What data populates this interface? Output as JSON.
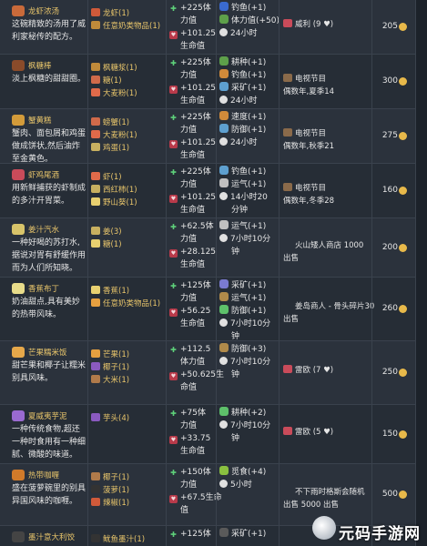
{
  "dishes": [
    {
      "name": "龙虾浓汤",
      "desc": "这碗精致的汤用了威\n利家秘传的配方。",
      "ingredients": [
        {
          "name": "龙虾(1)"
        },
        {
          "name": "任意奶类物品(1)"
        }
      ],
      "stats": [
        "+225体",
        "力值",
        "+101.25",
        "生命值"
      ],
      "buffs": [
        "钓鱼(+1)",
        "体力值(+50)",
        "24小时"
      ],
      "source": "威利 (9 ♥)",
      "price": "205"
    },
    {
      "name": "枫糖棒",
      "desc": "淡上枫糖的甜甜圈。",
      "ingredients": [
        {
          "name": "枫糖浆(1)"
        },
        {
          "name": "糖(1)"
        },
        {
          "name": "大麦粉(1)"
        }
      ],
      "stats": [
        "+225体",
        "力值",
        "+101.25",
        "生命值"
      ],
      "buffs": [
        "耕种(+1)",
        "钓鱼(+1)",
        "采矿(+1)",
        "24小时"
      ],
      "source": "电视节目\n偶数年,夏季14",
      "price": "300"
    },
    {
      "name": "蟹黄糕",
      "desc": "蟹肉、面包屑和鸡蛋\n做成饼状,然后油炸\n至金黄色。",
      "ingredients": [
        {
          "name": "螃蟹(1)"
        },
        {
          "name": "大麦粉(1)"
        },
        {
          "name": "鸡蛋(1)"
        }
      ],
      "stats": [
        "+225体",
        "力值",
        "+101.25",
        "生命值"
      ],
      "buffs": [
        "速度(+1)",
        "防御(+1)",
        "24小时"
      ],
      "source": "电视节目\n偶数年,秋季21",
      "price": "275"
    },
    {
      "name": "虾鸡尾酒",
      "desc": "用新鲜捕获的虾制成\n的多汁开胃菜。",
      "ingredients": [
        {
          "name": "虾(1)"
        },
        {
          "name": "西红柿(1)"
        },
        {
          "name": "野山葵(1)"
        }
      ],
      "stats": [
        "+225体",
        "力值",
        "+101.25",
        "生命值"
      ],
      "buffs": [
        "钓鱼(+1)",
        "运气(+1)",
        "14小时20",
        "分钟"
      ],
      "source": "电视节目\n偶数年,冬季28",
      "price": "160"
    },
    {
      "name": "姜汁汽水",
      "desc": "一种好喝的苏打水,\n据说对胃有舒缓作用\n而为人们所知晓。",
      "ingredients": [
        {
          "name": "姜(3)"
        },
        {
          "name": "糖(1)"
        }
      ],
      "stats": [
        "+62.5体",
        "力值",
        "+28.125",
        "生命值"
      ],
      "buffs": [
        "运气(+1)",
        "7小时10分",
        "钟"
      ],
      "source": "火山矮人商店  1000\n出售",
      "price": "200"
    },
    {
      "name": "香蕉布丁",
      "desc": "奶油甜点,具有美妙\n的热带风味。",
      "ingredients": [
        {
          "name": "香蕉(1)"
        },
        {
          "name": "任意奶类物品(1)"
        }
      ],
      "stats": [
        "+125体",
        "力值",
        "+56.25",
        "生命值"
      ],
      "buffs": [
        "采矿(+1)",
        "运气(+1)",
        "防御(+1)",
        "7小时10分",
        "钟"
      ],
      "source": "姜岛商人 - 骨头碎片30\n出售",
      "price": "260"
    },
    {
      "name": "芒果糯米饭",
      "desc": "甜芒果和椰子让糯米\n别具风味。",
      "ingredients": [
        {
          "name": "芒果(1)"
        },
        {
          "name": "椰子(1)"
        },
        {
          "name": "大米(1)"
        }
      ],
      "stats": [
        "+112.5",
        "体力值",
        "+50.625生",
        "命值"
      ],
      "buffs": [
        "防御(+3)",
        "7小时10分",
        "钟"
      ],
      "source": "雷欧 (7 ♥)",
      "price": "250"
    },
    {
      "name": "夏威夷芋泥",
      "desc": "一种传统食物,超还\n一种时食用有一种细\n腻、微酸的味道。",
      "ingredients": [
        {
          "name": "芋头(4)"
        }
      ],
      "stats": [
        "+75体",
        "力值",
        "+33.75",
        "生命值"
      ],
      "buffs": [
        "耕种(+2)",
        "7小时10分",
        "钟"
      ],
      "source": "雷欧 (5 ♥)",
      "price": "150"
    },
    {
      "name": "热带咖喱",
      "desc": "盛在菠萝碗里的别具\n异国风味的咖喱。",
      "ingredients": [
        {
          "name": "椰子(1)"
        },
        {
          "name": "菠萝(1)"
        },
        {
          "name": "辣椒(1)"
        }
      ],
      "stats": [
        "+150体",
        "力值",
        "+67.5生命",
        "值"
      ],
      "buffs": [
        "觅食(+4)",
        "5小时"
      ],
      "source": "不下雨时格斯会随机\n出售  5000 出售",
      "price": "500"
    },
    {
      "name": "墨汁意大利饺",
      "desc": "",
      "ingredients": [
        {
          "name": "鱿鱼墨汁(1)"
        }
      ],
      "stats": [
        "+125体"
      ],
      "buffs": [
        "采矿(+1)"
      ],
      "source": "",
      "price": ""
    }
  ],
  "colors": {
    "accent_gold": "#e8c56b",
    "plus_green": "#5ed17a",
    "heart_red": "#b83a4a",
    "coin_gold": "#e8b94a"
  },
  "icons": {
    "energy": "plus-icon",
    "health": "heart-icon",
    "duration": "clock-icon",
    "tv": "tv-icon",
    "price": "gold-coin-icon"
  },
  "watermark": {
    "text": "元码手游网"
  }
}
